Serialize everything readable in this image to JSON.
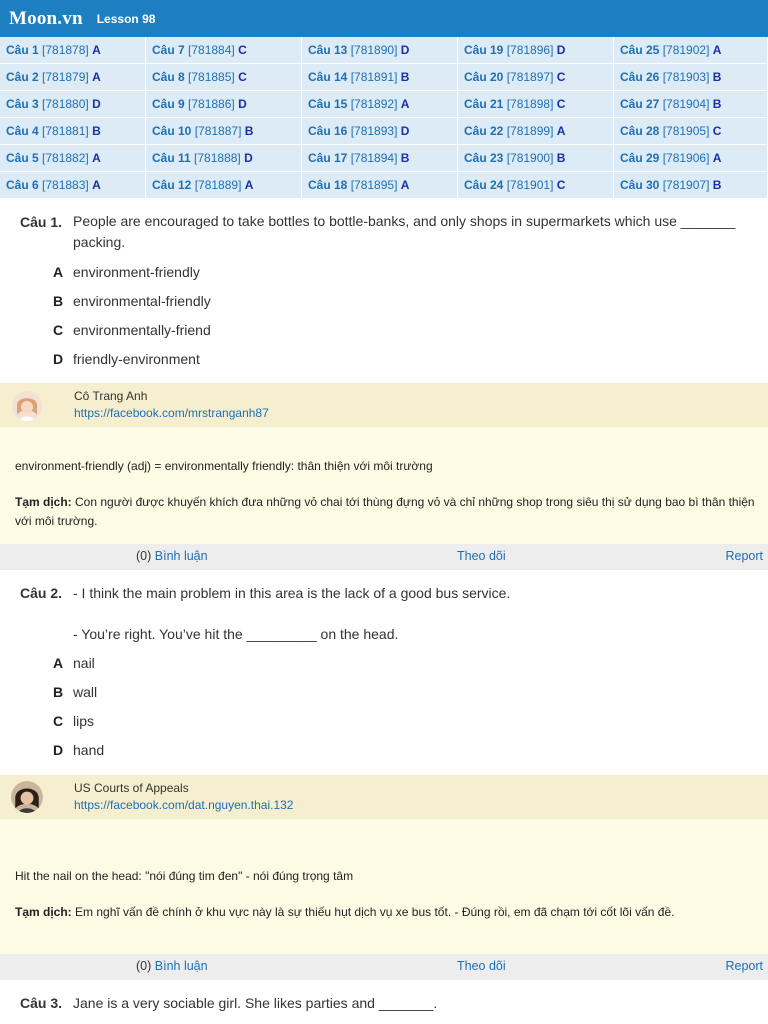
{
  "header": {
    "logo": "Moon.vn",
    "lesson": "Lesson 98"
  },
  "answer_key": [
    {
      "q": "Câu 1",
      "id": "[781878]",
      "ans": "A"
    },
    {
      "q": "Câu 7",
      "id": "[781884]",
      "ans": "C"
    },
    {
      "q": "Câu 13",
      "id": "[781890]",
      "ans": "D"
    },
    {
      "q": "Câu 19",
      "id": "[781896]",
      "ans": "D"
    },
    {
      "q": "Câu 25",
      "id": "[781902]",
      "ans": "A"
    },
    {
      "q": "Câu 2",
      "id": "[781879]",
      "ans": "A"
    },
    {
      "q": "Câu 8",
      "id": "[781885]",
      "ans": "C"
    },
    {
      "q": "Câu 14",
      "id": "[781891]",
      "ans": "B"
    },
    {
      "q": "Câu 20",
      "id": "[781897]",
      "ans": "C"
    },
    {
      "q": "Câu 26",
      "id": "[781903]",
      "ans": "B"
    },
    {
      "q": "Câu 3",
      "id": "[781880]",
      "ans": "D"
    },
    {
      "q": "Câu 9",
      "id": "[781886]",
      "ans": "D"
    },
    {
      "q": "Câu 15",
      "id": "[781892]",
      "ans": "A"
    },
    {
      "q": "Câu 21",
      "id": "[781898]",
      "ans": "C"
    },
    {
      "q": "Câu 27",
      "id": "[781904]",
      "ans": "B"
    },
    {
      "q": "Câu 4",
      "id": "[781881]",
      "ans": "B"
    },
    {
      "q": "Câu 10",
      "id": "[781887]",
      "ans": "B"
    },
    {
      "q": "Câu 16",
      "id": "[781893]",
      "ans": "D"
    },
    {
      "q": "Câu 22",
      "id": "[781899]",
      "ans": "A"
    },
    {
      "q": "Câu 28",
      "id": "[781905]",
      "ans": "C"
    },
    {
      "q": "Câu 5",
      "id": "[781882]",
      "ans": "A"
    },
    {
      "q": "Câu 11",
      "id": "[781888]",
      "ans": "D"
    },
    {
      "q": "Câu 17",
      "id": "[781894]",
      "ans": "B"
    },
    {
      "q": "Câu 23",
      "id": "[781900]",
      "ans": "B"
    },
    {
      "q": "Câu 29",
      "id": "[781906]",
      "ans": "A"
    },
    {
      "q": "Câu 6",
      "id": "[781883]",
      "ans": "A"
    },
    {
      "q": "Câu 12",
      "id": "[781889]",
      "ans": "A"
    },
    {
      "q": "Câu 18",
      "id": "[781895]",
      "ans": "A"
    },
    {
      "q": "Câu 24",
      "id": "[781901]",
      "ans": "C"
    },
    {
      "q": "Câu 30",
      "id": "[781907]",
      "ans": "B"
    }
  ],
  "q1": {
    "number": "Câu 1.",
    "text": "People are encouraged to take bottles to bottle-banks, and only shops in supermarkets which use _______ packing.",
    "options": [
      {
        "letter": "A",
        "text": "environment-friendly"
      },
      {
        "letter": "B",
        "text": "environmental-friendly"
      },
      {
        "letter": "C",
        "text": "environmentally-friend"
      },
      {
        "letter": "D",
        "text": "friendly-environment"
      }
    ],
    "author_name": "Cô Trang Anh",
    "author_link": "https://facebook.com/mrstranganh87",
    "explain_1": "environment-friendly (adj) = environmentally friendly: thân thiện với môi trường",
    "explain_label": "Tạm dịch:",
    "explain_2": " Con người được khuyến khích đưa những vỏ chai tới thùng đựng vỏ và chỉ những shop trong siêu thị  sử dụng bao bì thân thiện với môi trường.",
    "comment_count": "(0)",
    "comment_label": "Bình luận",
    "follow_label": "Theo dõi",
    "report_label": "Report"
  },
  "q2": {
    "number": "Câu 2.",
    "text_1": "- I think the main problem in this area is the lack of a good bus service.",
    "text_2": "- You’re right. You’ve hit the _________ on the head.",
    "options": [
      {
        "letter": "A",
        "text": "nail"
      },
      {
        "letter": "B",
        "text": "wall"
      },
      {
        "letter": "C",
        "text": "lips"
      },
      {
        "letter": "D",
        "text": "hand"
      }
    ],
    "author_name": "US Courts of Appeals",
    "author_link": "https://facebook.com/dat.nguyen.thai.132",
    "explain_1": "Hit the nail on the head: \"nói đúng tim đen\" - nói đúng trọng tâm",
    "explain_label": "Tạm dịch:",
    "explain_2": " Em nghĩ vấn đề chính ở khu vực này là sự thiếu hụt dịch vụ xe bus tốt. - Đúng rồi, em đã chạm tới cốt lõi vấn đề.",
    "comment_count": "(0)",
    "comment_label": "Bình luận",
    "follow_label": "Theo dõi",
    "report_label": "Report"
  },
  "q3": {
    "number": "Câu 3.",
    "text": "Jane is a very sociable girl. She likes parties and _______."
  },
  "colors": {
    "header_bg": "#1e7fc0",
    "grid_cell_bg": "#dcebf6",
    "link": "#1e6fb4",
    "answer_letter": "#1a2fa8",
    "author_bg": "#f5efcf",
    "explain_bg": "#fdfbe4",
    "footer_bg": "#ededed"
  }
}
